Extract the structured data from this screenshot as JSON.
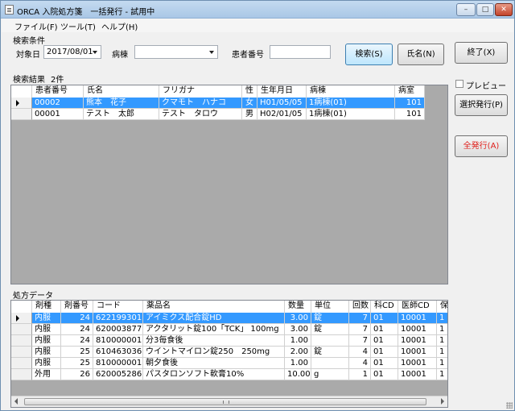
{
  "window": {
    "title": "ORCA 入院処方箋　一括発行 - 試用中",
    "buttons": {
      "minimize": "–",
      "maximize": "□",
      "close": "✕"
    }
  },
  "menu": [
    "ファイル(F)",
    "ツール(T)",
    "ヘルプ(H)"
  ],
  "search": {
    "section_label": "検索条件",
    "date_label": "対象日",
    "date_value": "2017/08/01",
    "ward_label": "病棟",
    "ward_value": "",
    "patient_no_label": "患者番号",
    "patient_no_value": "",
    "search_button": "検索(S)",
    "name_button": "氏名(N)"
  },
  "side": {
    "exit_button": "終了(X)",
    "preview_label": "プレビュー",
    "preview_checked": false,
    "select_issue_button": "選択発行(P)",
    "all_issue_button": "全発行(A)"
  },
  "results": {
    "label": "検索結果",
    "count": "2件",
    "columns": [
      "患者番号",
      "氏名",
      "フリガナ",
      "性",
      "生年月日",
      "病棟",
      "病室"
    ],
    "rows": [
      [
        "00002",
        "熊本　花子",
        "クマモト　ハナコ",
        "女",
        "H01/05/05",
        "1病棟(01)",
        "101"
      ],
      [
        "00001",
        "テスト　太郎",
        "テスト　タロウ",
        "男",
        "H02/01/05",
        "1病棟(01)",
        "101"
      ]
    ],
    "selected_row": 0
  },
  "prescriptions": {
    "label": "処方データ",
    "columns": [
      "剤種",
      "剤番号",
      "コード",
      "薬品名",
      "数量",
      "単位",
      "回数",
      "科CD",
      "医師CD",
      "保"
    ],
    "rows": [
      [
        "内服",
        "24",
        "622199301",
        "アイミクス配合錠HD",
        "3.00",
        "錠",
        "7",
        "01",
        "10001",
        "1"
      ],
      [
        "内服",
        "24",
        "620003877",
        "アクタリット錠100「TCK」 100mg",
        "3.00",
        "錠",
        "7",
        "01",
        "10001",
        "1"
      ],
      [
        "内服",
        "24",
        "810000001",
        "分3毎食後",
        "1.00",
        "",
        "7",
        "01",
        "10001",
        "1"
      ],
      [
        "内服",
        "25",
        "610463036",
        "ウイントマイロン錠250　250mg",
        "2.00",
        "錠",
        "4",
        "01",
        "10001",
        "1"
      ],
      [
        "内服",
        "25",
        "810000001",
        "朝夕食後",
        "1.00",
        "",
        "4",
        "01",
        "10001",
        "1"
      ],
      [
        "外用",
        "26",
        "620005286",
        "パスタロンソフト軟膏10%",
        "10.00",
        "g",
        "1",
        "01",
        "10001",
        "1"
      ]
    ],
    "selected_row": 0,
    "scrollbar_grip": "III"
  }
}
